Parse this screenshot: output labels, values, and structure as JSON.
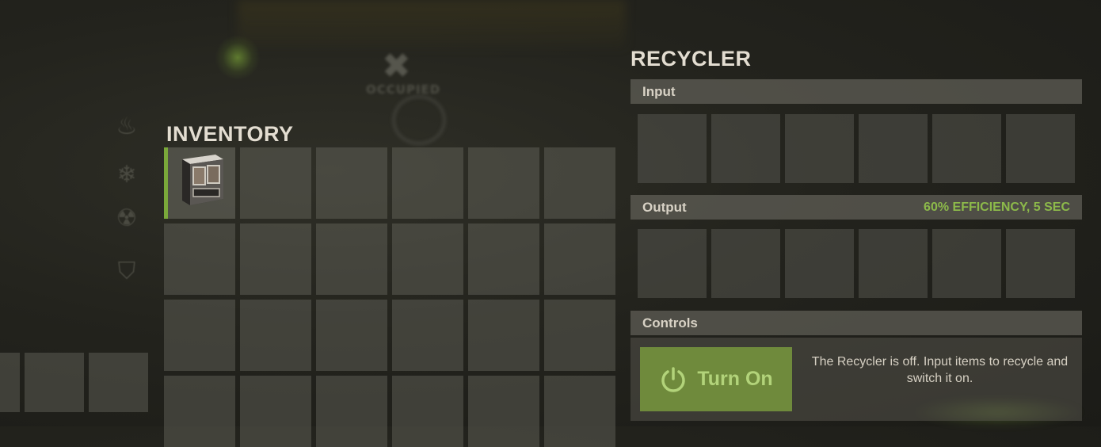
{
  "inventory": {
    "title": "INVENTORY",
    "rows": 4,
    "cols": 6,
    "selected_slot": 0,
    "item_icon": "storage-cabinet-icon"
  },
  "belt": {
    "visible_slots": 3
  },
  "background": {
    "occupied_label": "OCCUPIED",
    "side_icons": [
      "flame-icon",
      "snowflake-icon",
      "radiation-icon",
      "armor-icon"
    ]
  },
  "recycler": {
    "title": "RECYCLER",
    "input": {
      "label": "Input",
      "slots": 6
    },
    "output": {
      "label": "Output",
      "efficiency": "60% EFFICIENCY, 5 SEC",
      "slots": 6
    },
    "controls": {
      "label": "Controls",
      "button_label": "Turn On",
      "button_icon": "power-icon",
      "status": "The Recycler is off. Input items to recycle and switch it on."
    }
  },
  "colors": {
    "accent_green": "#7aa83a",
    "efficiency_text": "#8cb94a",
    "button_bg": "#6f8a3c",
    "button_text": "#b2d37a"
  }
}
